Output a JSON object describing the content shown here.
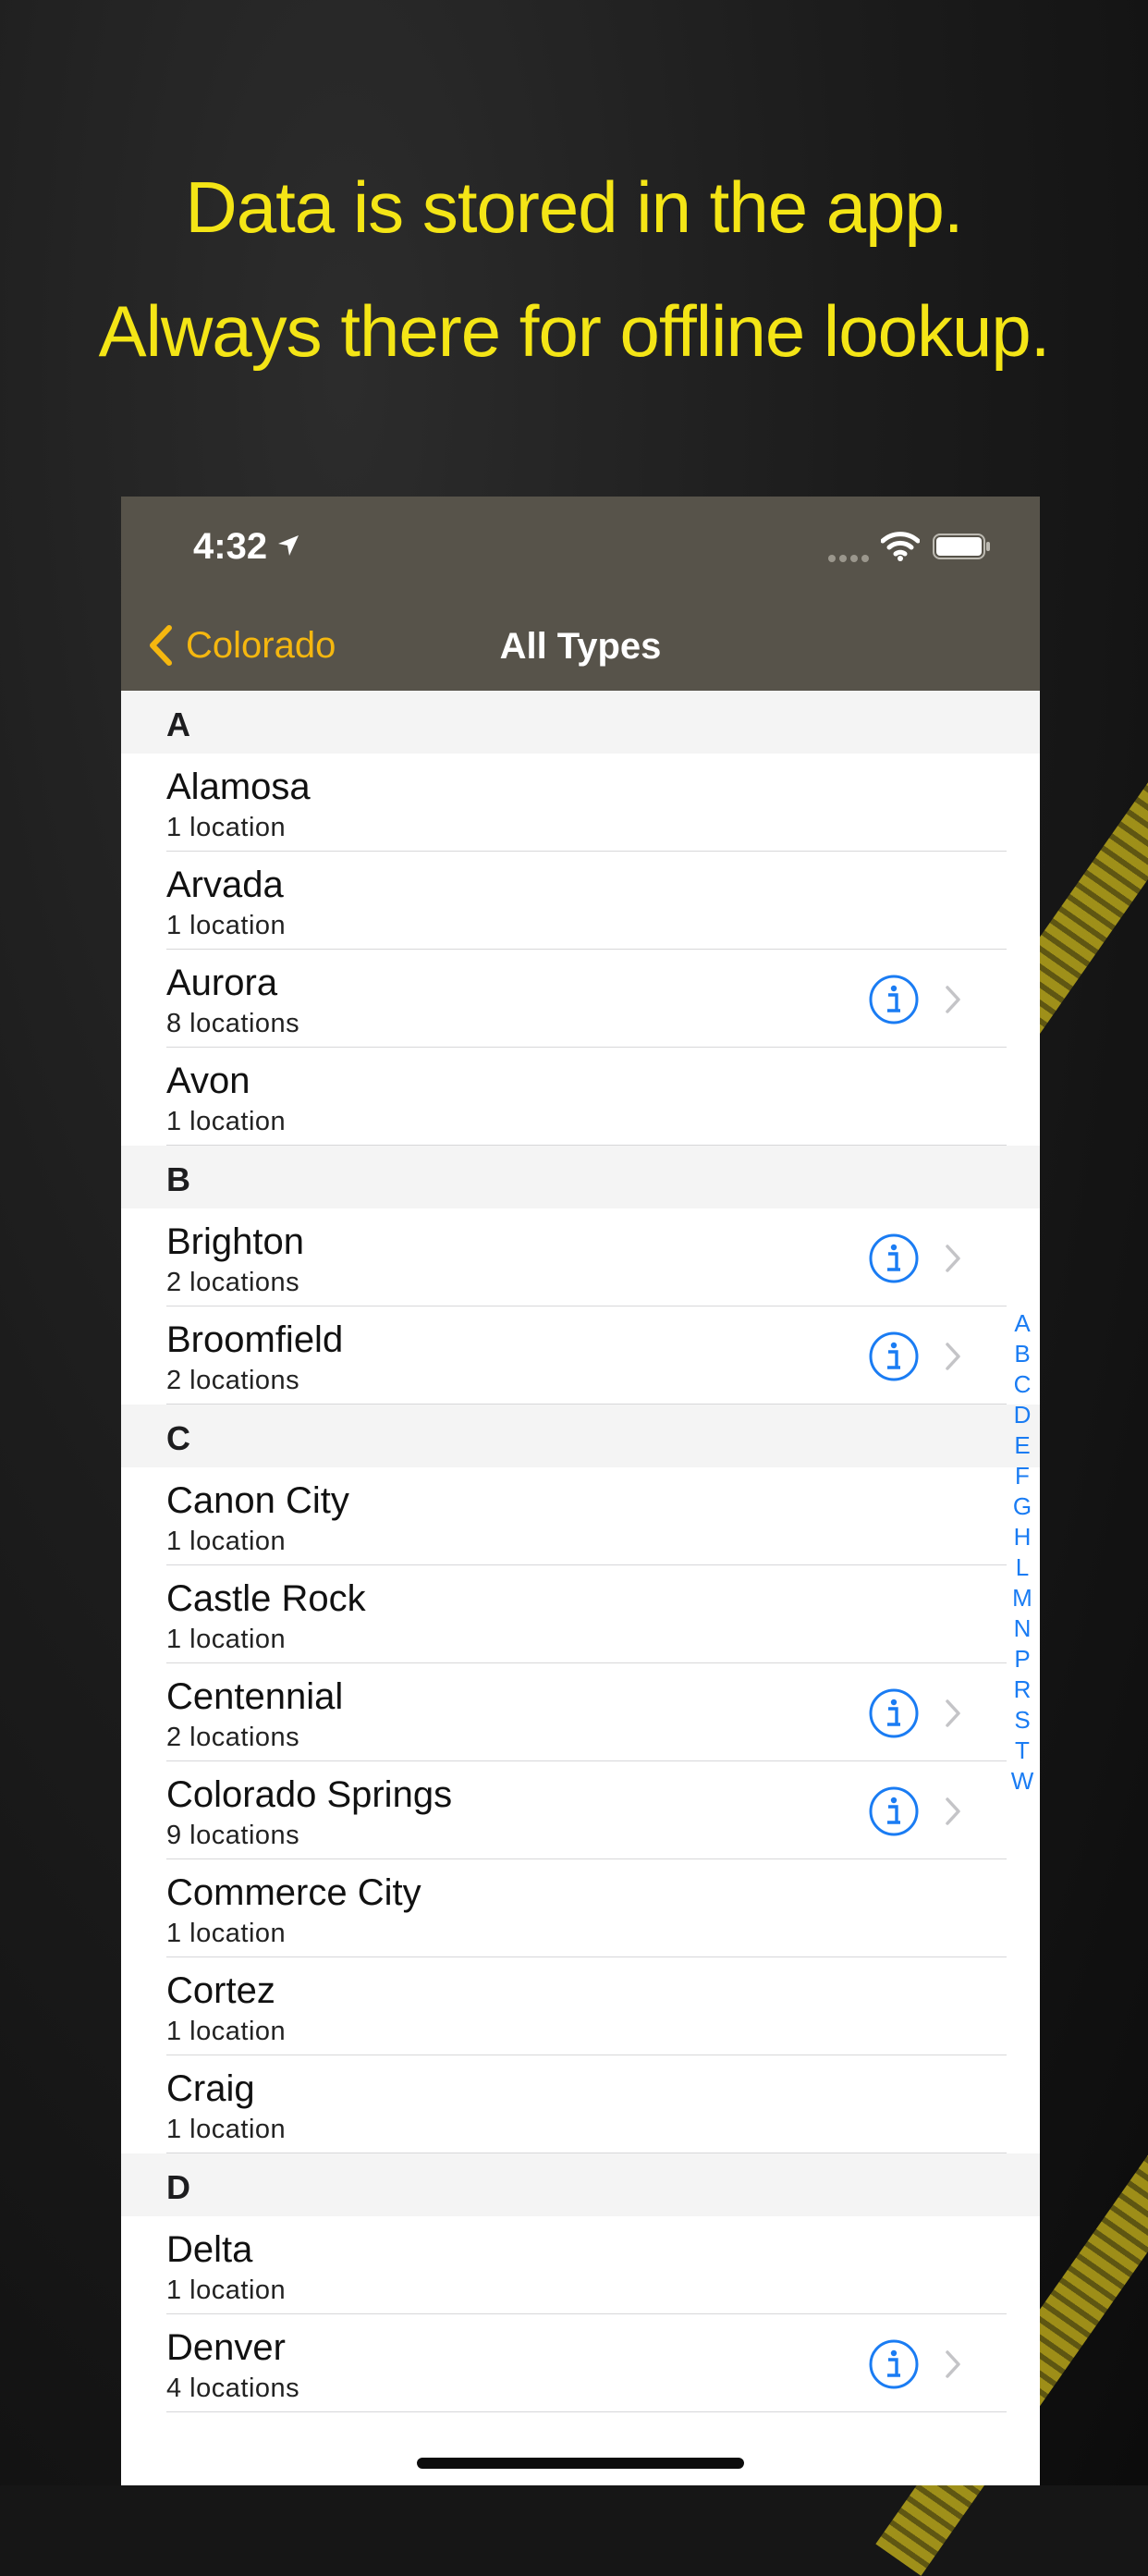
{
  "promo": {
    "line1": "Data is stored in the app.",
    "line2": "Always there for offline lookup."
  },
  "status_bar": {
    "time": "4:32"
  },
  "nav": {
    "back_label": "Colorado",
    "title": "All Types"
  },
  "sections": [
    {
      "letter": "A",
      "rows": [
        {
          "name": "Alamosa",
          "count": "1 location",
          "detail": false
        },
        {
          "name": "Arvada",
          "count": "1 location",
          "detail": false
        },
        {
          "name": "Aurora",
          "count": "8 locations",
          "detail": true
        },
        {
          "name": "Avon",
          "count": "1 location",
          "detail": false
        }
      ]
    },
    {
      "letter": "B",
      "rows": [
        {
          "name": "Brighton",
          "count": "2 locations",
          "detail": true
        },
        {
          "name": "Broomfield",
          "count": "2 locations",
          "detail": true
        }
      ]
    },
    {
      "letter": "C",
      "rows": [
        {
          "name": "Canon City",
          "count": "1 location",
          "detail": false
        },
        {
          "name": "Castle Rock",
          "count": "1 location",
          "detail": false
        },
        {
          "name": "Centennial",
          "count": "2 locations",
          "detail": true
        },
        {
          "name": "Colorado Springs",
          "count": "9 locations",
          "detail": true
        },
        {
          "name": "Commerce City",
          "count": "1 location",
          "detail": false
        },
        {
          "name": "Cortez",
          "count": "1 location",
          "detail": false
        },
        {
          "name": "Craig",
          "count": "1 location",
          "detail": false
        }
      ]
    },
    {
      "letter": "D",
      "rows": [
        {
          "name": "Delta",
          "count": "1 location",
          "detail": false
        },
        {
          "name": "Denver",
          "count": "4 locations",
          "detail": true
        }
      ]
    }
  ],
  "index_letters": [
    "A",
    "B",
    "C",
    "D",
    "E",
    "F",
    "G",
    "H",
    "L",
    "M",
    "N",
    "P",
    "R",
    "S",
    "T",
    "W"
  ],
  "colors": {
    "accent": "#f5b70f",
    "link_blue": "#1a7cf3",
    "headline_yellow": "#f4e516",
    "bar_bg": "#57534a"
  }
}
